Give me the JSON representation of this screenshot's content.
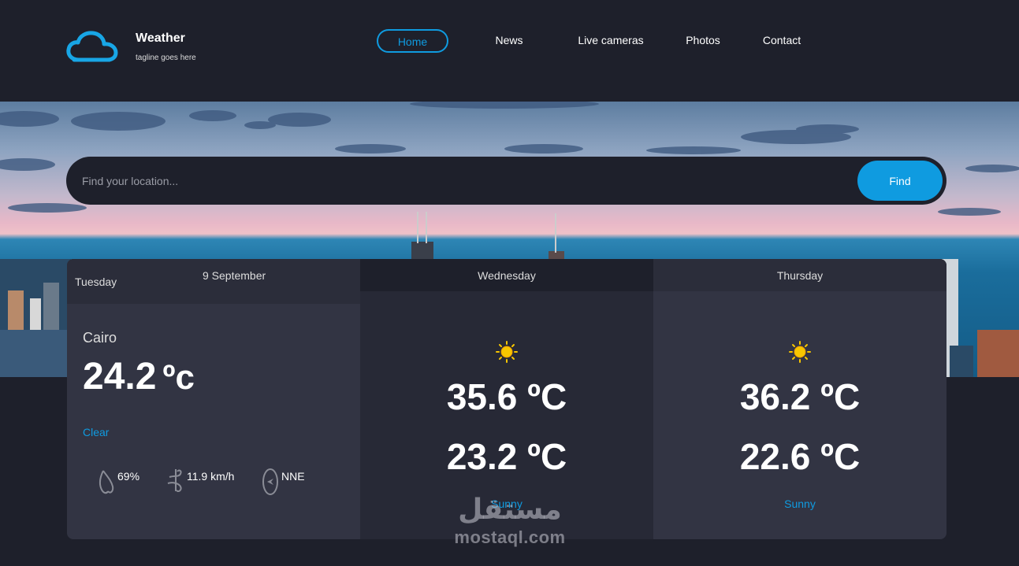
{
  "header": {
    "brand_name": "Weather",
    "tagline": "tagline goes here",
    "logo_icon": "cloud-icon",
    "nav": [
      {
        "label": "Home",
        "active": true
      },
      {
        "label": "News"
      },
      {
        "label": "Live cameras"
      },
      {
        "label": "Photos"
      },
      {
        "label": "Contact"
      }
    ]
  },
  "search": {
    "placeholder": "Find your location...",
    "button_label": "Find"
  },
  "today": {
    "day": "Tuesday",
    "date": "9 September",
    "city": "Cairo",
    "temp": "24.2",
    "unit": "ºc",
    "condition": "Clear",
    "icon": "moon-icon",
    "humidity": "69%",
    "wind_speed": "11.9 km/h",
    "wind_dir": "NNE"
  },
  "forecast": [
    {
      "day": "Wednesday",
      "max": "35.6 ºC",
      "min": "23.2 ºC",
      "condition": "Sunny",
      "icon": "sun-icon"
    },
    {
      "day": "Thursday",
      "max": "36.2 ºC",
      "min": "22.6 ºC",
      "condition": "Sunny",
      "icon": "sun-icon"
    }
  ],
  "watermark": {
    "arabic": "مستقل",
    "latin": "mostaql.com"
  },
  "colors": {
    "accent": "#0f9be0",
    "background": "#1e202b",
    "panel": "#323443"
  }
}
